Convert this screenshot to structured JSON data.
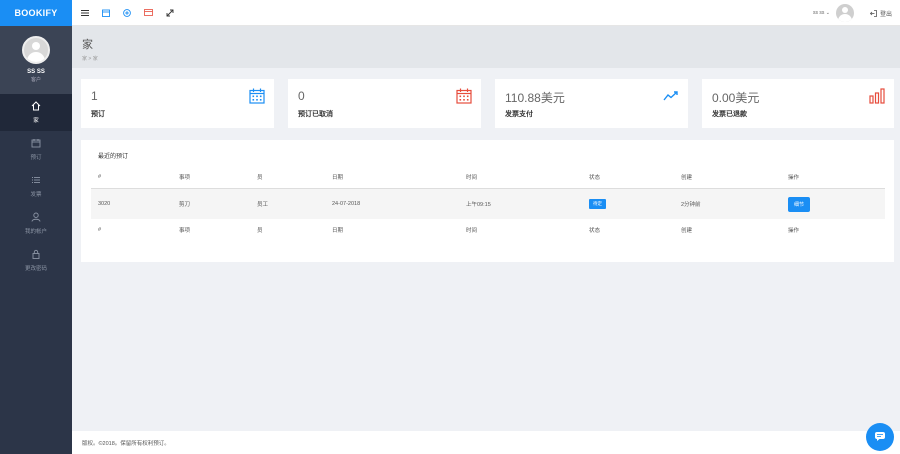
{
  "brand": "BOOKIFY",
  "profile": {
    "name": "SS SS",
    "role": "客户"
  },
  "sidebar": {
    "items": [
      {
        "label": "家",
        "icon": "home-icon",
        "active": true
      },
      {
        "label": "预订",
        "icon": "calendar-icon",
        "active": false
      },
      {
        "label": "发票",
        "icon": "list-icon",
        "active": false
      },
      {
        "label": "我的帐户",
        "icon": "user-icon",
        "active": false
      },
      {
        "label": "更改密码",
        "icon": "lock-icon",
        "active": false
      }
    ]
  },
  "topbar": {
    "icons": [
      "menu-icon",
      "calendar-icon",
      "plus-circle-icon",
      "card-icon",
      "expand-icon"
    ],
    "user_label": "ss ss",
    "logout_label": "登出"
  },
  "page": {
    "title": "家",
    "breadcrumb": "家 > 家"
  },
  "stats": [
    {
      "value": "1",
      "label": "预订",
      "icon": "calendar-icon",
      "color": "#1a8ef4"
    },
    {
      "value": "0",
      "label": "预订已取消",
      "icon": "calendar-icon",
      "color": "#e74c3c"
    },
    {
      "value": "110.88美元",
      "label": "发票支付",
      "icon": "trend-line-icon",
      "color": "#1a8ef4"
    },
    {
      "value": "0.00美元",
      "label": "发票已退款",
      "icon": "bar-chart-icon",
      "color": "#e74c3c"
    }
  ],
  "bookings": {
    "title": "最近的预订",
    "columns": [
      "#",
      "事项",
      "员",
      "日期",
      "时间",
      "状态",
      "创建",
      "操作"
    ],
    "rows": [
      {
        "id": "3020",
        "item": "剪刀",
        "staff": "员工",
        "date": "24-07-2018",
        "time": "上午09:15",
        "status": "待定",
        "created": "2分钟前",
        "action": "细节"
      }
    ]
  },
  "footer": "版权。©2018。保留所有权利预订。",
  "colors": {
    "accent": "#1a8ef4",
    "danger": "#e74c3c",
    "sidebar": "#2c3548"
  }
}
